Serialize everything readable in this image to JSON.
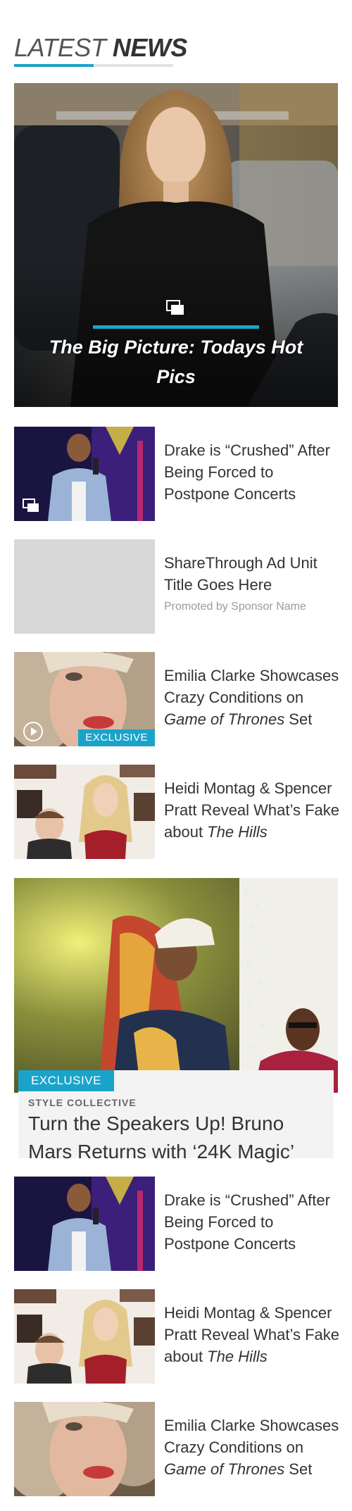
{
  "section": {
    "title_light": "LATEST",
    "title_bold": "NEWS"
  },
  "hero": {
    "title": "The Big Picture: Todays Hot Pics",
    "icon": "gallery-icon"
  },
  "items": [
    {
      "title": "Drake is “Crushed” After Being Forced to Postpone Concerts",
      "icon": "gallery-icon"
    },
    {
      "title": "ShareThrough Ad Unit Title Goes Here",
      "sponsor": "Promoted by Sponsor Name"
    },
    {
      "title_pre": "Emilia Clarke Showcases Crazy Conditions on ",
      "title_em": "Game of Thrones",
      "title_post": " Set",
      "badge": "EXCLUSIVE",
      "icon": "play-icon"
    },
    {
      "title_pre": "Heidi Montag & Spencer Pratt Reveal What’s Fake about ",
      "title_em": "The Hills",
      "title_post": ""
    }
  ],
  "feature": {
    "badge": "EXCLUSIVE",
    "kicker": "STYLE COLLECTIVE",
    "title": "Turn the Speakers Up! Bruno Mars Returns with ‘24K Magic’"
  },
  "items2": [
    {
      "title": "Drake is “Crushed” After Being Forced to Postpone Concerts"
    },
    {
      "title_pre": "Heidi Montag & Spencer Pratt Reveal What’s Fake about ",
      "title_em": "The Hills",
      "title_post": ""
    },
    {
      "title_pre": "Emilia Clarke Showcases Crazy Conditions on ",
      "title_em": "Game of Thrones",
      "title_post": " Set"
    }
  ],
  "colors": {
    "accent": "#1aa3c9",
    "text": "#333333",
    "muted": "#9a9a9a",
    "card_bg": "#f3f3f3"
  }
}
